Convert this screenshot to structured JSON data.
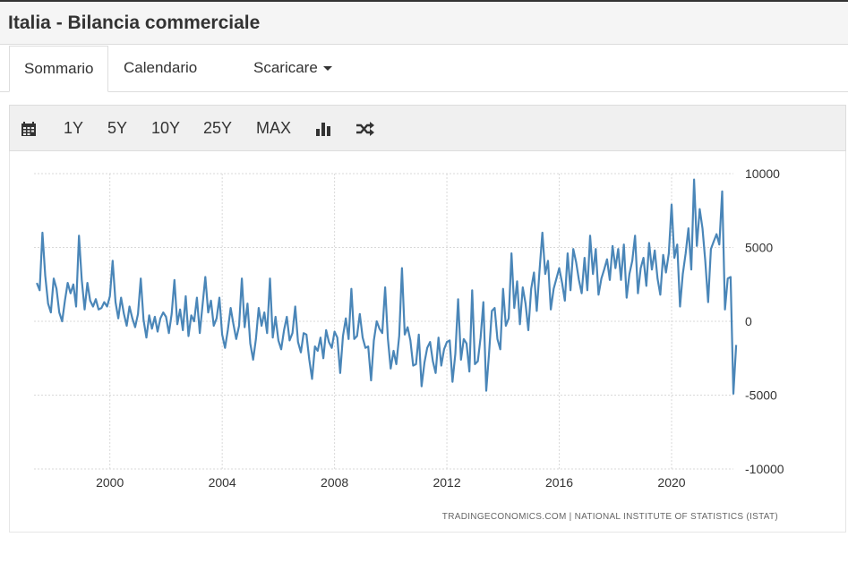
{
  "header": {
    "title": "Italia - Bilancia commerciale"
  },
  "tabs": [
    {
      "label": "Sommario",
      "active": true
    },
    {
      "label": "Calendario",
      "active": false
    },
    {
      "label": "Scaricare",
      "active": false
    }
  ],
  "toolbar": {
    "calendar_icon": "calendar-icon",
    "ranges": [
      "1Y",
      "5Y",
      "10Y",
      "25Y",
      "MAX"
    ],
    "bar_chart_icon": "bar-chart-icon",
    "shuffle_icon": "shuffle-icon"
  },
  "colors": {
    "line": "#4a86b8",
    "grid": "#d9d9d9",
    "text": "#333333"
  },
  "chart_data": {
    "type": "line",
    "title": "",
    "xlabel": "",
    "ylabel": "",
    "ylim": [
      -10000,
      10000
    ],
    "y_ticks": [
      10000,
      5000,
      0,
      -5000,
      -10000
    ],
    "y_tick_labels": [
      "10000",
      "5000",
      "0",
      "-5000",
      "-10000"
    ],
    "x_ticks": [
      2000,
      2004,
      2008,
      2012,
      2016,
      2020
    ],
    "x_tick_labels": [
      "2000",
      "2004",
      "2008",
      "2012",
      "2016",
      "2020"
    ],
    "xlim": [
      1997.3,
      2022.2
    ],
    "grid": true,
    "source": "TRADINGECONOMICS.COM  |  NATIONAL INSTITUTE OF STATISTICS (ISTAT)",
    "series": [
      {
        "values": [
          [
            1997.4,
            2600
          ],
          [
            1997.5,
            2100
          ],
          [
            1997.6,
            6000
          ],
          [
            1997.7,
            3100
          ],
          [
            1997.8,
            1200
          ],
          [
            1997.9,
            600
          ],
          [
            1998.0,
            2900
          ],
          [
            1998.1,
            2200
          ],
          [
            1998.2,
            600
          ],
          [
            1998.3,
            0
          ],
          [
            1998.4,
            1400
          ],
          [
            1998.5,
            2600
          ],
          [
            1998.6,
            1900
          ],
          [
            1998.7,
            2500
          ],
          [
            1998.8,
            1000
          ],
          [
            1998.9,
            5800
          ],
          [
            1999.0,
            2800
          ],
          [
            1999.1,
            800
          ],
          [
            1999.2,
            2600
          ],
          [
            1999.3,
            1400
          ],
          [
            1999.4,
            1000
          ],
          [
            1999.5,
            1500
          ],
          [
            1999.6,
            800
          ],
          [
            1999.7,
            900
          ],
          [
            1999.8,
            1300
          ],
          [
            1999.9,
            1000
          ],
          [
            2000.0,
            1700
          ],
          [
            2000.1,
            4100
          ],
          [
            2000.2,
            1300
          ],
          [
            2000.3,
            200
          ],
          [
            2000.4,
            1600
          ],
          [
            2000.5,
            500
          ],
          [
            2000.6,
            -300
          ],
          [
            2000.7,
            1000
          ],
          [
            2000.8,
            200
          ],
          [
            2000.9,
            -400
          ],
          [
            2001.0,
            500
          ],
          [
            2001.1,
            2900
          ],
          [
            2001.2,
            100
          ],
          [
            2001.3,
            -1100
          ],
          [
            2001.4,
            400
          ],
          [
            2001.5,
            -500
          ],
          [
            2001.6,
            300
          ],
          [
            2001.7,
            -700
          ],
          [
            2001.8,
            200
          ],
          [
            2001.9,
            600
          ],
          [
            2002.0,
            300
          ],
          [
            2002.1,
            -800
          ],
          [
            2002.2,
            500
          ],
          [
            2002.3,
            2800
          ],
          [
            2002.4,
            -200
          ],
          [
            2002.5,
            800
          ],
          [
            2002.6,
            -600
          ],
          [
            2002.7,
            1700
          ],
          [
            2002.8,
            -1000
          ],
          [
            2002.9,
            400
          ],
          [
            2003.0,
            0
          ],
          [
            2003.1,
            1600
          ],
          [
            2003.2,
            -800
          ],
          [
            2003.3,
            1100
          ],
          [
            2003.4,
            3000
          ],
          [
            2003.5,
            600
          ],
          [
            2003.6,
            1400
          ],
          [
            2003.7,
            -300
          ],
          [
            2003.8,
            200
          ],
          [
            2003.9,
            1600
          ],
          [
            2004.0,
            -900
          ],
          [
            2004.1,
            -1800
          ],
          [
            2004.2,
            -600
          ],
          [
            2004.3,
            900
          ],
          [
            2004.4,
            -200
          ],
          [
            2004.5,
            -1200
          ],
          [
            2004.6,
            -300
          ],
          [
            2004.7,
            2900
          ],
          [
            2004.8,
            -400
          ],
          [
            2004.9,
            1200
          ],
          [
            2005.0,
            -1500
          ],
          [
            2005.1,
            -2600
          ],
          [
            2005.2,
            -1200
          ],
          [
            2005.3,
            900
          ],
          [
            2005.4,
            -300
          ],
          [
            2005.5,
            600
          ],
          [
            2005.6,
            -800
          ],
          [
            2005.7,
            2900
          ],
          [
            2005.8,
            -1100
          ],
          [
            2005.9,
            300
          ],
          [
            2006.0,
            -1300
          ],
          [
            2006.1,
            -1900
          ],
          [
            2006.2,
            -600
          ],
          [
            2006.3,
            300
          ],
          [
            2006.4,
            -1300
          ],
          [
            2006.5,
            -800
          ],
          [
            2006.6,
            1000
          ],
          [
            2006.7,
            -1400
          ],
          [
            2006.8,
            -2100
          ],
          [
            2006.9,
            -800
          ],
          [
            2007.0,
            -900
          ],
          [
            2007.1,
            -2600
          ],
          [
            2007.2,
            -3900
          ],
          [
            2007.3,
            -1700
          ],
          [
            2007.4,
            -2000
          ],
          [
            2007.5,
            -1100
          ],
          [
            2007.6,
            -2500
          ],
          [
            2007.7,
            -600
          ],
          [
            2007.8,
            -1400
          ],
          [
            2007.9,
            -1800
          ],
          [
            2008.0,
            -700
          ],
          [
            2008.1,
            -1100
          ],
          [
            2008.2,
            -3500
          ],
          [
            2008.3,
            -1000
          ],
          [
            2008.4,
            200
          ],
          [
            2008.5,
            -1200
          ],
          [
            2008.6,
            2200
          ],
          [
            2008.7,
            -1200
          ],
          [
            2008.8,
            -1000
          ],
          [
            2008.9,
            500
          ],
          [
            2009.0,
            -1100
          ],
          [
            2009.1,
            -1800
          ],
          [
            2009.2,
            -1700
          ],
          [
            2009.3,
            -4000
          ],
          [
            2009.4,
            -1300
          ],
          [
            2009.5,
            0
          ],
          [
            2009.6,
            -500
          ],
          [
            2009.7,
            -800
          ],
          [
            2009.8,
            2300
          ],
          [
            2009.9,
            -1200
          ],
          [
            2010.0,
            -3200
          ],
          [
            2010.1,
            -2000
          ],
          [
            2010.2,
            -2900
          ],
          [
            2010.3,
            -1000
          ],
          [
            2010.4,
            3600
          ],
          [
            2010.5,
            -900
          ],
          [
            2010.6,
            -400
          ],
          [
            2010.7,
            -1300
          ],
          [
            2010.8,
            -3000
          ],
          [
            2010.9,
            -2900
          ],
          [
            2011.0,
            -900
          ],
          [
            2011.1,
            -4400
          ],
          [
            2011.2,
            -2800
          ],
          [
            2011.3,
            -1800
          ],
          [
            2011.4,
            -1400
          ],
          [
            2011.5,
            -2700
          ],
          [
            2011.6,
            -3500
          ],
          [
            2011.7,
            -1100
          ],
          [
            2011.8,
            -3000
          ],
          [
            2011.9,
            -1900
          ],
          [
            2012.0,
            -1400
          ],
          [
            2012.1,
            -1300
          ],
          [
            2012.2,
            -4100
          ],
          [
            2012.3,
            -2200
          ],
          [
            2012.4,
            1500
          ],
          [
            2012.5,
            -2600
          ],
          [
            2012.6,
            -1200
          ],
          [
            2012.7,
            -1500
          ],
          [
            2012.8,
            -3400
          ],
          [
            2012.9,
            2100
          ],
          [
            2013.0,
            -2900
          ],
          [
            2013.1,
            -2700
          ],
          [
            2013.2,
            -1100
          ],
          [
            2013.3,
            1300
          ],
          [
            2013.4,
            -4700
          ],
          [
            2013.5,
            -2200
          ],
          [
            2013.6,
            700
          ],
          [
            2013.7,
            900
          ],
          [
            2013.8,
            -1200
          ],
          [
            2013.9,
            -1900
          ],
          [
            2014.0,
            2200
          ],
          [
            2014.1,
            -300
          ],
          [
            2014.2,
            200
          ],
          [
            2014.3,
            4600
          ],
          [
            2014.4,
            900
          ],
          [
            2014.5,
            2700
          ],
          [
            2014.6,
            -200
          ],
          [
            2014.7,
            2300
          ],
          [
            2014.8,
            1200
          ],
          [
            2014.9,
            -600
          ],
          [
            2015.0,
            2200
          ],
          [
            2015.1,
            3300
          ],
          [
            2015.2,
            700
          ],
          [
            2015.3,
            3500
          ],
          [
            2015.4,
            6000
          ],
          [
            2015.5,
            3200
          ],
          [
            2015.6,
            4100
          ],
          [
            2015.7,
            800
          ],
          [
            2015.8,
            2200
          ],
          [
            2015.9,
            2900
          ],
          [
            2016.0,
            3600
          ],
          [
            2016.1,
            2600
          ],
          [
            2016.2,
            1400
          ],
          [
            2016.3,
            4600
          ],
          [
            2016.4,
            2100
          ],
          [
            2016.5,
            4900
          ],
          [
            2016.6,
            4000
          ],
          [
            2016.7,
            2800
          ],
          [
            2016.8,
            1900
          ],
          [
            2016.9,
            4300
          ],
          [
            2017.0,
            2100
          ],
          [
            2017.1,
            5800
          ],
          [
            2017.2,
            3200
          ],
          [
            2017.3,
            4900
          ],
          [
            2017.4,
            1800
          ],
          [
            2017.5,
            2900
          ],
          [
            2017.6,
            3500
          ],
          [
            2017.7,
            4200
          ],
          [
            2017.8,
            2800
          ],
          [
            2017.9,
            5100
          ],
          [
            2018.0,
            3600
          ],
          [
            2018.1,
            4900
          ],
          [
            2018.2,
            2800
          ],
          [
            2018.3,
            5200
          ],
          [
            2018.4,
            1600
          ],
          [
            2018.5,
            3200
          ],
          [
            2018.6,
            4100
          ],
          [
            2018.7,
            5800
          ],
          [
            2018.8,
            1900
          ],
          [
            2018.9,
            3600
          ],
          [
            2019.0,
            4300
          ],
          [
            2019.1,
            2400
          ],
          [
            2019.2,
            5300
          ],
          [
            2019.3,
            3500
          ],
          [
            2019.4,
            4800
          ],
          [
            2019.5,
            2900
          ],
          [
            2019.6,
            1800
          ],
          [
            2019.7,
            4500
          ],
          [
            2019.8,
            3300
          ],
          [
            2019.9,
            4600
          ],
          [
            2020.0,
            7900
          ],
          [
            2020.1,
            4300
          ],
          [
            2020.2,
            5200
          ],
          [
            2020.3,
            1000
          ],
          [
            2020.4,
            3200
          ],
          [
            2020.5,
            4600
          ],
          [
            2020.6,
            6300
          ],
          [
            2020.7,
            3500
          ],
          [
            2020.8,
            9600
          ],
          [
            2020.9,
            5100
          ],
          [
            2021.0,
            7600
          ],
          [
            2021.1,
            6300
          ],
          [
            2021.2,
            4100
          ],
          [
            2021.3,
            1300
          ],
          [
            2021.4,
            4900
          ],
          [
            2021.5,
            5400
          ],
          [
            2021.6,
            5900
          ],
          [
            2021.7,
            5200
          ],
          [
            2021.8,
            8800
          ],
          [
            2021.9,
            800
          ],
          [
            2022.0,
            2900
          ],
          [
            2022.1,
            3000
          ],
          [
            2022.2,
            -4900
          ],
          [
            2022.3,
            -1600
          ]
        ]
      }
    ]
  }
}
